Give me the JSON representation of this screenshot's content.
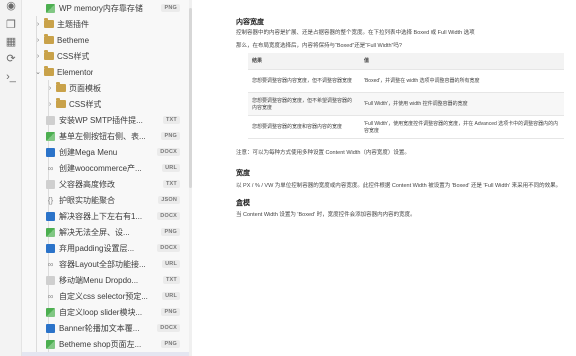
{
  "activity_icons": [
    "bulb-icon",
    "files-icon",
    "calendar-icon",
    "sync-icon",
    "terminal-icon"
  ],
  "tree": [
    {
      "label": "WP memory内存靠存储",
      "badge": "PNG",
      "type": "img",
      "indent": 2
    },
    {
      "label": "主题插件",
      "badge": "",
      "type": "folder",
      "indent": 1,
      "expanded": false
    },
    {
      "label": "Betheme",
      "badge": "",
      "type": "folder",
      "indent": 1,
      "expanded": false
    },
    {
      "label": "CSS样式",
      "badge": "",
      "type": "folder",
      "indent": 1,
      "expanded": false
    },
    {
      "label": "Elementor",
      "badge": "",
      "type": "folder",
      "indent": 1,
      "expanded": true
    },
    {
      "label": "页面模板",
      "badge": "",
      "type": "folder",
      "indent": 2,
      "expanded": false
    },
    {
      "label": "CSS样式",
      "badge": "",
      "type": "folder",
      "indent": 2,
      "expanded": false
    },
    {
      "label": "安装WP SMTP插件提...",
      "badge": "TXT",
      "type": "txt",
      "indent": 2
    },
    {
      "label": "基单左侧按钮右侧、表...",
      "badge": "PNG",
      "type": "img",
      "indent": 2
    },
    {
      "label": "创建Mega Menu",
      "badge": "DOCX",
      "type": "doc",
      "indent": 2
    },
    {
      "label": "创建woocommerce产...",
      "badge": "URL",
      "type": "link",
      "indent": 2
    },
    {
      "label": "父容器高度修改",
      "badge": "TXT",
      "type": "txt",
      "indent": 2
    },
    {
      "label": "护眼实功能聚合",
      "badge": "JSON",
      "type": "json",
      "indent": 2
    },
    {
      "label": "解决容器上下左右有1...",
      "badge": "DOCX",
      "type": "doc",
      "indent": 2
    },
    {
      "label": "解决无法全屏、设...",
      "badge": "PNG",
      "type": "img",
      "indent": 2
    },
    {
      "label": "弃用padding设置层...",
      "badge": "DOCX",
      "type": "doc",
      "indent": 2
    },
    {
      "label": "容器Layout全部功能接...",
      "badge": "URL",
      "type": "link",
      "indent": 2
    },
    {
      "label": "移动端Menu Dropdo...",
      "badge": "TXT",
      "type": "txt",
      "indent": 2
    },
    {
      "label": "自定义css selector预定...",
      "badge": "URL",
      "type": "link",
      "indent": 2
    },
    {
      "label": "自定义loop slider模块...",
      "badge": "PNG",
      "type": "img",
      "indent": 2
    },
    {
      "label": "Banner轮播加文本覆...",
      "badge": "DOCX",
      "type": "doc",
      "indent": 2
    },
    {
      "label": "Betheme shop页面左...",
      "badge": "PNG",
      "type": "img",
      "indent": 2
    },
    {
      "label": "boxed和full width的...",
      "badge": "PNG",
      "type": "img",
      "indent": 2,
      "selected": true
    }
  ],
  "document": {
    "h1": "内容宽度",
    "p1": "控制容器中的内容是扩展、还是占据容器的整个宽度。在下拉列表中选择 Boxed 或 Full Width 选项",
    "p2": "那么，在布局宽度选择后，内容将保持与“Boxed”还是“Full Width”吗?",
    "table_head": [
      "结果",
      "值"
    ],
    "table_rows": [
      [
        "您想要调整容器内容宽度，但不调整容器宽度",
        "'Boxed'，并调整在 width 选项中调整容器的所有宽度"
      ],
      [
        "您想要调整容器的宽度，但不希望调整容器的内容宽度",
        "'Full Width'，并使用 width 控件调整容器的宽度"
      ],
      [
        "您想要调整容器的宽度和容器内容的宽度",
        "'Full Width'，使用宽度控件调整容器的宽度，并在 Advanced 选项卡中的调整容器内的内容宽度"
      ]
    ],
    "note": "注意：可以为每种方式使用多种设置 Content Width（内容宽度）设置。",
    "h2": "宽度",
    "p3": "以 PX / % / VW 为单位控制容器的宽度或内容宽度。此控件根据 Content Width 被设置为 'Boxed' 还是 'Full Width' 来采用不同的效果。",
    "h3": "盒模",
    "p4": "当 Content Width 设置为 'Boxed' 时，宽度控件会添加容器内内容的宽度。"
  }
}
